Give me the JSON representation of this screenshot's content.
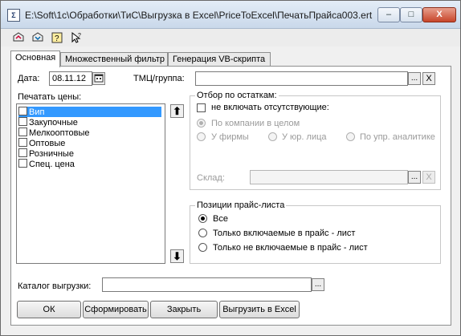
{
  "window": {
    "title": "E:\\Soft\\1c\\Обработки\\ТиС\\Выгрузка в Excel\\PriceToExcel\\ПечатьПрайса003.ert",
    "icon": "1c-app-icon",
    "controls": {
      "minimize": "–",
      "maximize": "□",
      "close": "X"
    }
  },
  "toolbar": {
    "icons": [
      "load-settings-icon",
      "save-settings-icon",
      "help-icon",
      "pointer-help-icon"
    ]
  },
  "tabs": [
    {
      "label": "Основная",
      "active": true
    },
    {
      "label": "Множественный фильтр",
      "active": false
    },
    {
      "label": "Генерация VB-скрипта",
      "active": false
    }
  ],
  "main": {
    "date_label": "Дата:",
    "date_value": "08.11.12",
    "tmc_label": "ТМЦ/группа:",
    "tmc_value": "",
    "tmc_select": "...",
    "tmc_clear": "X",
    "print_prices_label": "Печатать цены:",
    "prices": [
      {
        "label": "Вип",
        "checked": false,
        "selected": true
      },
      {
        "label": "Закупочные",
        "checked": false,
        "selected": false
      },
      {
        "label": "Мелкооптовые",
        "checked": false,
        "selected": false
      },
      {
        "label": "Оптовые",
        "checked": false,
        "selected": false
      },
      {
        "label": "Розничные",
        "checked": false,
        "selected": false
      },
      {
        "label": "Спец. цена",
        "checked": false,
        "selected": false
      }
    ],
    "move_up": "⬆",
    "move_down": "⬇",
    "stock_filter": {
      "title": "Отбор по остаткам:",
      "exclude_absent": "не включать отсутствующие:",
      "by_company": "По компании в целом",
      "by_firm": "У фирмы",
      "by_legal": "У юр. лица",
      "by_analytics": "По упр. аналитике",
      "warehouse_label": "Склад:",
      "warehouse_value": "",
      "warehouse_select": "...",
      "warehouse_clear": "X"
    },
    "positions": {
      "title": "Позиции прайс-листа",
      "all": "Все",
      "only_included": "Только включаемые в прайс - лист",
      "only_excluded": "Только не включаемые в прайс - лист",
      "selected": "all"
    },
    "catalog_label": "Каталог выгрузки:",
    "catalog_value": "",
    "catalog_select": "..."
  },
  "buttons": {
    "ok": "ОК",
    "build": "Сформировать",
    "close": "Закрыть",
    "export": "Выгрузить в Excel"
  }
}
